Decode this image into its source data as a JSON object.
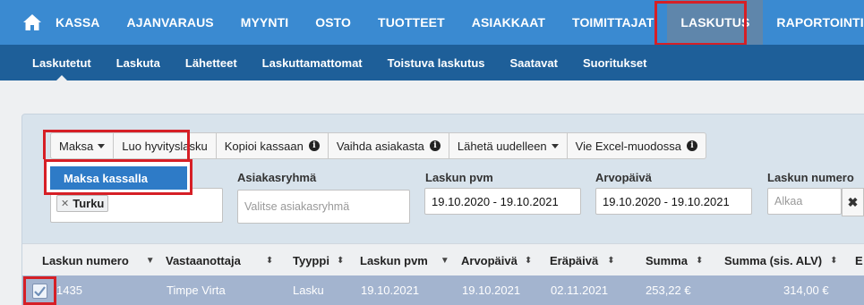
{
  "topnav": {
    "items": [
      "KASSA",
      "AJANVARAUS",
      "MYYNTI",
      "OSTO",
      "TUOTTEET",
      "ASIAKKAAT",
      "TOIMITTAJAT",
      "LASKUTUS",
      "RAPORTOINTI"
    ],
    "active": "LASKUTUS"
  },
  "subnav": {
    "items": [
      "Laskutetut",
      "Laskuta",
      "Lähetteet",
      "Laskuttamattomat",
      "Toistuva laskutus",
      "Saatavat",
      "Suoritukset"
    ],
    "active": "Laskutetut"
  },
  "toolbar": {
    "maksa": "Maksa",
    "luo_hyvityslasku": "Luo hyvityslasku",
    "kopioi_kassaan": "Kopioi kassaan",
    "vaihda_asiakasta": "Vaihda asiakasta",
    "laheta_uudelleen": "Lähetä uudelleen",
    "vie_excel": "Vie Excel-muodossa"
  },
  "dropdown": {
    "option": "Maksa kassalla"
  },
  "filters": {
    "tag": "Turku",
    "asiakasryhma_label": "Asiakasryhmä",
    "asiakasryhma_placeholder": "Valitse asiakasryhmä",
    "laskun_pvm_label": "Laskun pvm",
    "laskun_pvm_value": "19.10.2020 - 19.10.2021",
    "arvopaiva_label": "Arvopäivä",
    "arvopaiva_value": "19.10.2020 - 19.10.2021",
    "laskun_numero_label": "Laskun numero",
    "laskun_numero_placeholder": "Alkaa",
    "clear": "✖"
  },
  "table": {
    "headers": [
      "Laskun numero",
      "Vastaanottaja",
      "Tyyppi",
      "Laskun pvm",
      "Arvopäivä",
      "Eräpäivä",
      "Summa",
      "Summa (sis. ALV)",
      "E"
    ],
    "rows": [
      [
        "1435",
        "Timpe Virta",
        "Lasku",
        "19.10.2021",
        "19.10.2021",
        "02.11.2021",
        "253,22 €",
        "314,00 €"
      ]
    ]
  },
  "colors": {
    "topnav": "#3a8ad1",
    "subnav": "#1e5f99",
    "highlight": "#d61f26",
    "selected_row": "#a3b4cf",
    "dropdown_option": "#2e7bc7"
  }
}
